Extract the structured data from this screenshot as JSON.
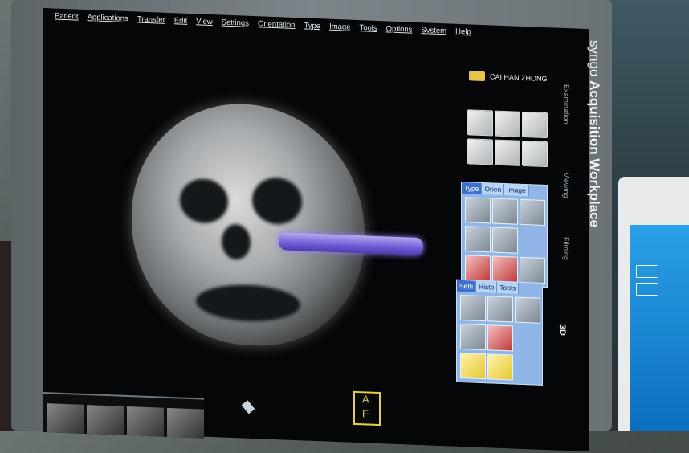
{
  "menubar": {
    "items": [
      "Patient",
      "Applications",
      "Transfer",
      "Edit",
      "View",
      "Settings",
      "Orientation",
      "Type",
      "Image",
      "Tools",
      "Options",
      "System",
      "Help"
    ]
  },
  "patient": {
    "name": "CAI HAN ZHONG"
  },
  "panel_type": {
    "tabs": [
      "Type",
      "Orien",
      "Image"
    ],
    "active": "Type"
  },
  "panel_tools": {
    "tabs": [
      "Setti",
      "Histo",
      "Tools"
    ],
    "active": "Setti"
  },
  "side_tabs": [
    "Examination",
    "Viewing",
    "Filming"
  ],
  "mode_label": "3D",
  "orientation_cube": {
    "top": "A",
    "front": "F"
  },
  "brand": {
    "name": "syngo",
    "title": "Acquisition Workplace"
  },
  "colors": {
    "screen": "#050607",
    "panel": "#8fb6e6",
    "active_tab": "#3f6fd0",
    "probe": "#7c68e0",
    "cube": "#e4d23a"
  }
}
